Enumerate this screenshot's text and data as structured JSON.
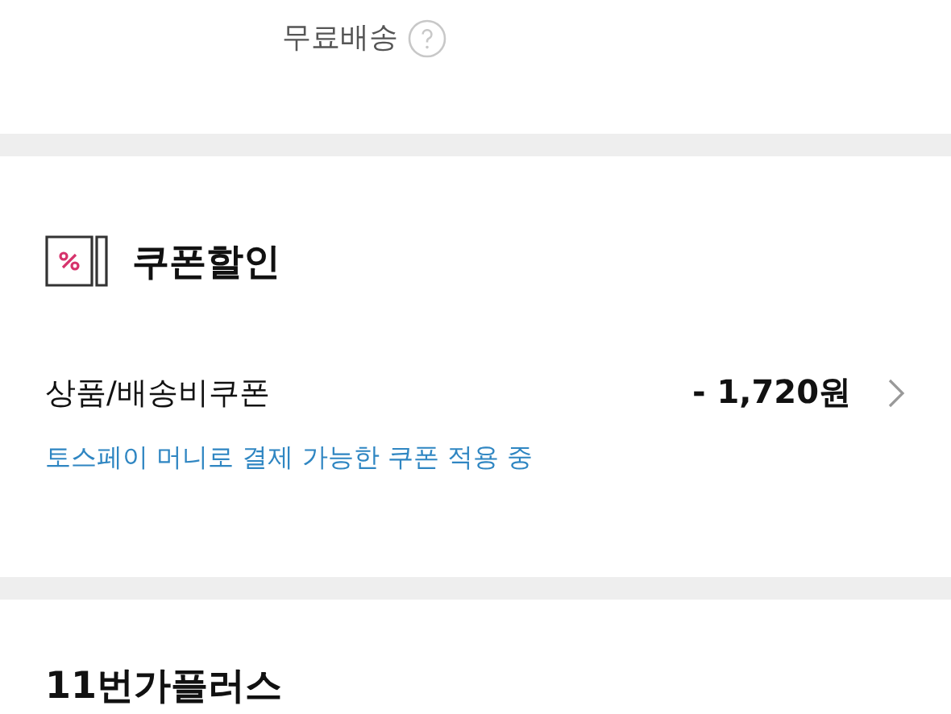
{
  "shipping": {
    "label": "무료배송"
  },
  "coupon_section": {
    "title": "쿠폰할인",
    "row": {
      "label": "상품/배송비쿠폰",
      "amount": "- 1,720원"
    },
    "notice": "토스페이 머니로 결제 가능한 쿠폰 적용 중"
  },
  "next_section": {
    "title": "11번가플러스"
  }
}
